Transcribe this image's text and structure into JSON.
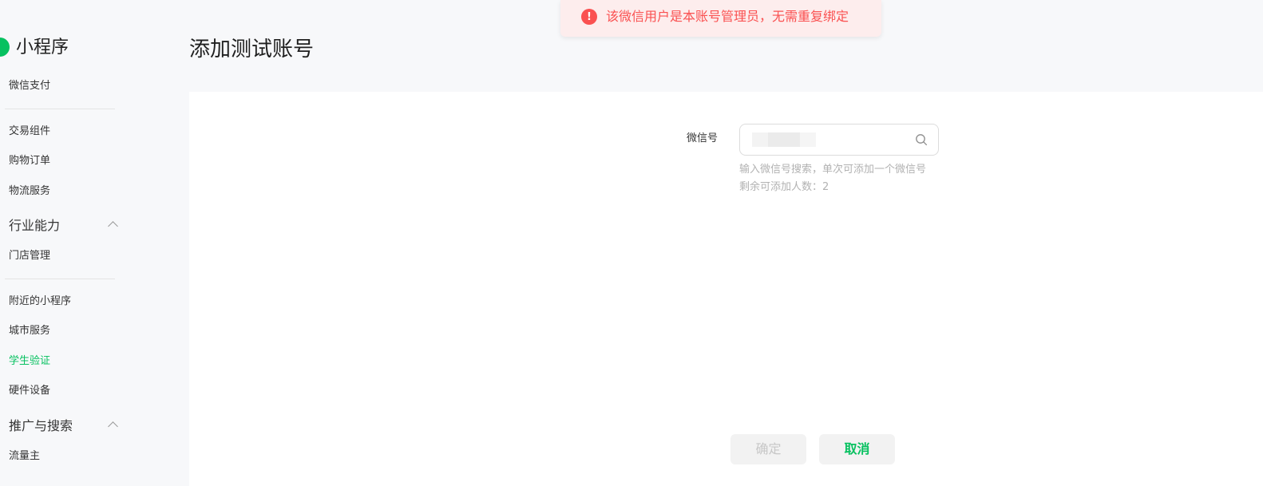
{
  "brand": {
    "title": "小程序"
  },
  "sidebar": {
    "items": [
      {
        "label": "微信支付"
      },
      {
        "label": "交易组件"
      },
      {
        "label": "购物订单"
      },
      {
        "label": "物流服务"
      },
      {
        "label": "门店管理"
      },
      {
        "label": "附近的小程序"
      },
      {
        "label": "城市服务"
      },
      {
        "label": "学生验证",
        "active": true
      },
      {
        "label": "硬件设备"
      },
      {
        "label": "流量主"
      }
    ],
    "groups": [
      {
        "label": "行业能力",
        "expanded": true
      },
      {
        "label": "推广与搜索",
        "expanded": true
      }
    ]
  },
  "header": {
    "title": "添加测试账号"
  },
  "toast": {
    "icon": "!",
    "message": "该微信用户是本账号管理员，无需重复绑定",
    "color": "#fa5151"
  },
  "form": {
    "field_label": "微信号",
    "hint": "输入微信号搜索，单次可添加一个微信号",
    "remaining_label": "剩余可添加人数：",
    "remaining_count": "2"
  },
  "actions": {
    "confirm_label": "确定",
    "cancel_label": "取消"
  },
  "colors": {
    "accent": "#07c160",
    "error": "#fa5151"
  }
}
